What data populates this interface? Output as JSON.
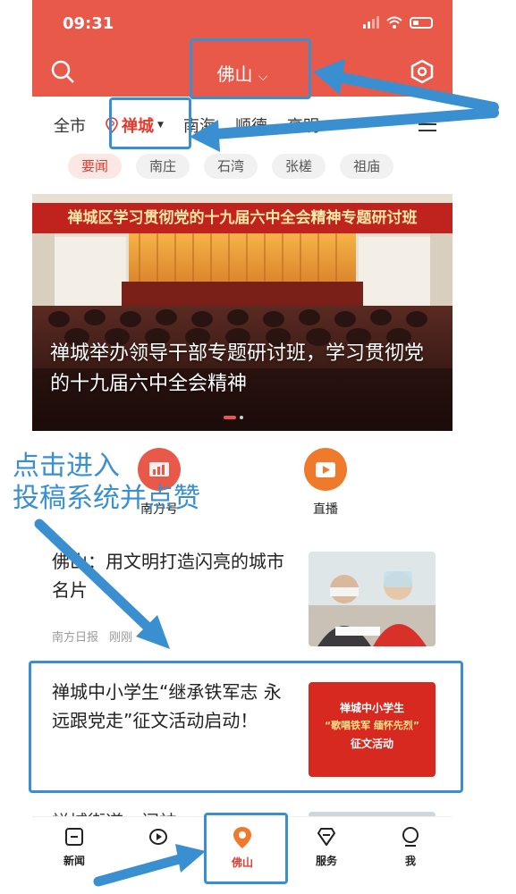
{
  "status_bar": {
    "time": "09:31"
  },
  "header": {
    "city": "佛山"
  },
  "tabs": [
    "全市",
    "禅城",
    "南海",
    "顺德",
    "高明"
  ],
  "chips": [
    "要闻",
    "南庄",
    "石湾",
    "张槎",
    "祖庙"
  ],
  "hero": {
    "banner": "禅城区学习贯彻党的十九届六中全会精神专题研讨班",
    "title": "禅城举办领导干部专题研讨班，学习贯彻党的十九届六中全会精神"
  },
  "quick_links": [
    {
      "label": "南方号",
      "icon": "chart-icon"
    },
    {
      "label": "直播",
      "icon": "play-icon"
    }
  ],
  "news": [
    {
      "title": "佛山：用文明打造闪亮的城市名片",
      "source": "南方日报",
      "time": "刚刚"
    },
    {
      "title": "禅城中小学生“继承铁军志 永远跟党走”征文活动启动！",
      "thumb_line1": "禅城中小学生",
      "thumb_line2": "“歌唱铁军 缅怀先烈”",
      "thumb_line3": "征文活动"
    },
    {
      "title": "禅城街道一间神",
      "partial": true
    }
  ],
  "bottom_nav": [
    {
      "label": "新闻",
      "icon": "news-icon"
    },
    {
      "label": "",
      "icon": "video-icon"
    },
    {
      "label": "佛山",
      "icon": "location-icon"
    },
    {
      "label": "服务",
      "icon": "service-icon"
    },
    {
      "label": "我",
      "icon": "profile-icon"
    }
  ],
  "annotation": {
    "line1": "点击进入",
    "line2": "投稿系统并点赞"
  },
  "colors": {
    "brand_red": "#e8594a",
    "active_red": "#e23b2e",
    "annotation_blue": "#3a8fd0"
  }
}
